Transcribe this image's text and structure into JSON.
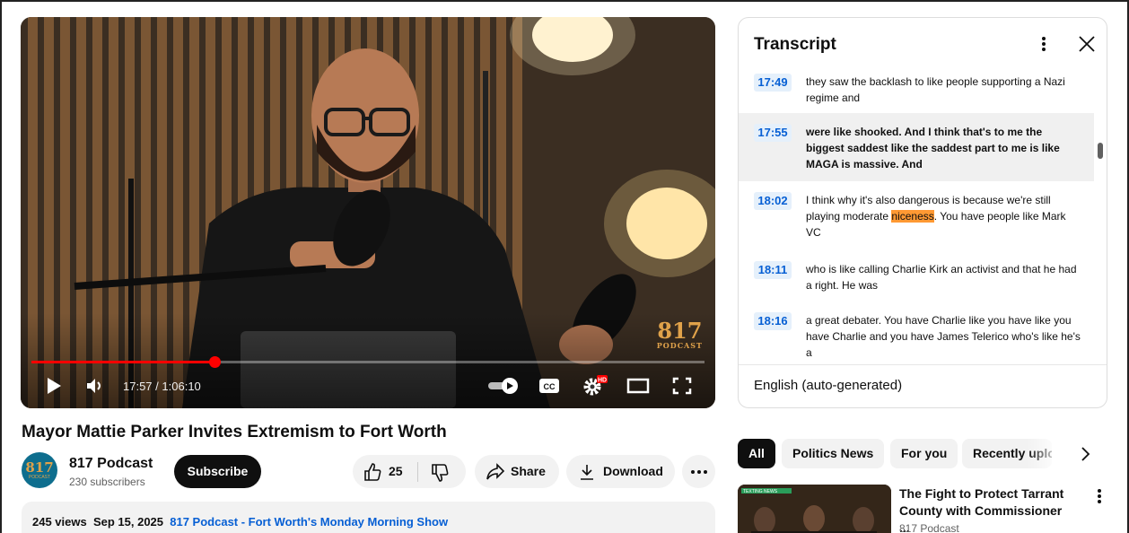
{
  "player": {
    "time_current": "17:57",
    "time_total": "1:06:10",
    "progress_fraction": 0.272,
    "logo_number": "817",
    "logo_text": "PODCAST",
    "hd_badge": "HD",
    "cc_label": "CC"
  },
  "video": {
    "title": "Mayor Mattie Parker Invites Extremism to Fort Worth",
    "channel_name": "817 Podcast",
    "subscribers": "230 subscribers",
    "subscribe_label": "Subscribe",
    "like_count": "25",
    "share_label": "Share",
    "download_label": "Download",
    "views": "245 views",
    "date": "Sep 15, 2025",
    "desc_link": "817 Podcast - Fort Worth's Monday Morning Show"
  },
  "transcript": {
    "title": "Transcript",
    "language": "English (auto-generated)",
    "segments": [
      {
        "time": "17:49",
        "text": "they saw the backlash to like people supporting a Nazi regime and"
      },
      {
        "time": "17:55",
        "text": "were like shooked. And I think that's to me the biggest saddest like the saddest part to me is like MAGA is massive. And"
      },
      {
        "time": "18:02",
        "text_before": "I think why it's also dangerous is because we're still playing moderate ",
        "highlight": "niceness",
        "text_after": ". You have people like Mark VC"
      },
      {
        "time": "18:11",
        "text": "who is like calling Charlie Kirk an activist and that he had a right. He was"
      },
      {
        "time": "18:16",
        "text": "a great debater. You have Charlie like you have like you have Charlie and you have James Telerico who's like he's a"
      }
    ]
  },
  "chips": [
    "All",
    "Politics News",
    "For you",
    "Recently uploaded"
  ],
  "recommendation": {
    "title": "The Fight to Protect Tarrant County with Commissioner ...",
    "channel": "817 Podcast",
    "thumb_caption": "TEXTING NEWS"
  }
}
